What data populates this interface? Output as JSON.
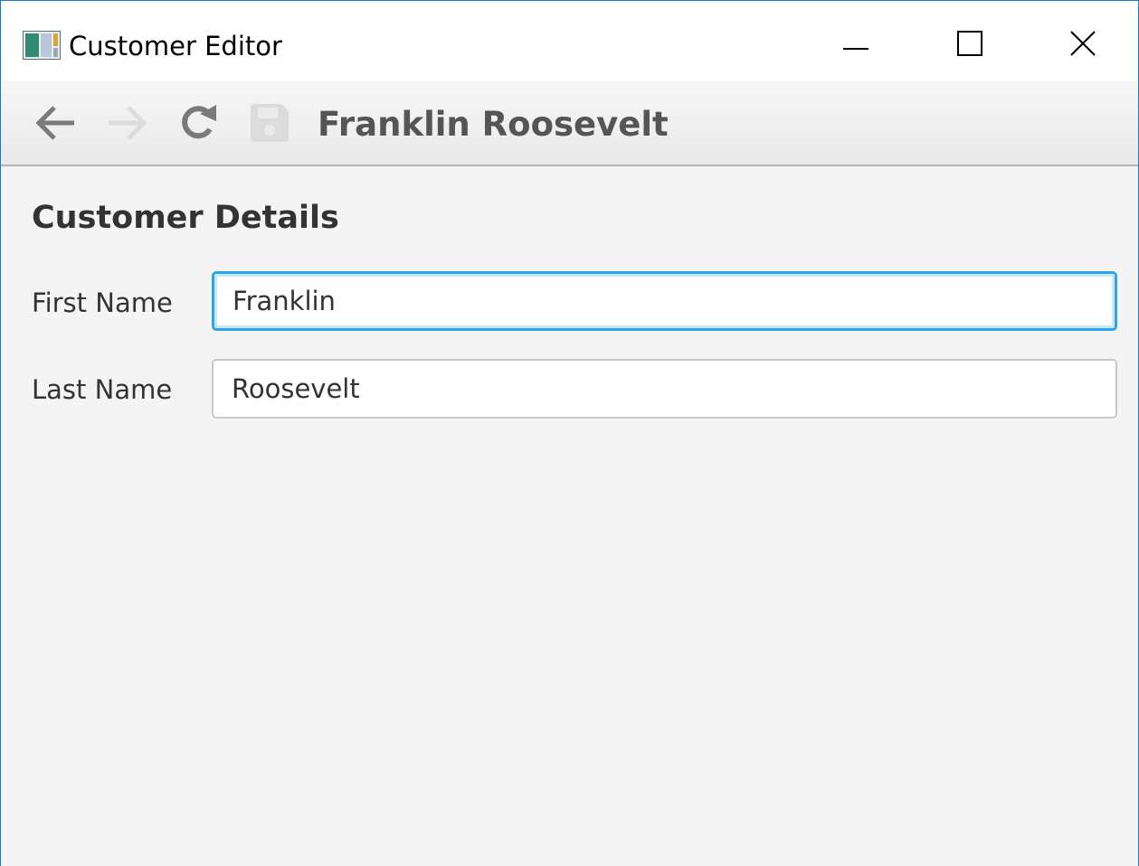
{
  "window": {
    "title": "Customer Editor",
    "icon": "app-window-icon",
    "controls": [
      "minimize-icon",
      "maximize-icon",
      "close-icon"
    ],
    "border_color": "#1979ca"
  },
  "toolbar": {
    "buttons": [
      {
        "name": "back",
        "icon": "arrow-left-icon",
        "enabled": true
      },
      {
        "name": "forward",
        "icon": "arrow-right-icon",
        "enabled": false
      },
      {
        "name": "refresh",
        "icon": "refresh-icon",
        "enabled": true
      },
      {
        "name": "save",
        "icon": "floppy-disk-icon",
        "enabled": false
      }
    ],
    "record_title": "Franklin Roosevelt"
  },
  "content": {
    "section_title": "Customer Details",
    "fields": {
      "first_name": {
        "label": "First Name",
        "value": "Franklin",
        "focused": true
      },
      "last_name": {
        "label": "Last Name",
        "value": "Roosevelt",
        "focused": false
      }
    }
  },
  "colors": {
    "focus_ring": "#2fa4e7",
    "background": "#f4f4f4",
    "disabled_icon": "#dcdcdc",
    "enabled_icon": "#7a7a7a"
  }
}
